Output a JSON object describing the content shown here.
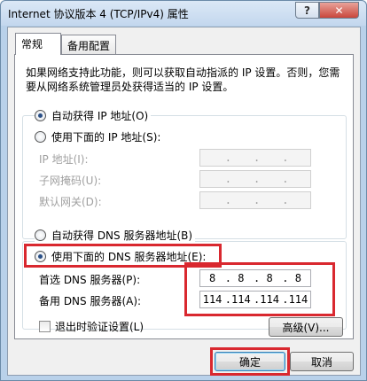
{
  "window": {
    "title": "Internet 协议版本 4 (TCP/IPv4) 属性",
    "help_glyph": "?",
    "close_glyph": "✕"
  },
  "tabs": [
    {
      "label": "常规",
      "active": true
    },
    {
      "label": "备用配置",
      "active": false
    }
  ],
  "description": "如果网络支持此功能，则可以获取自动指派的 IP 设置。否则，您需要从网络系统管理员处获得适当的 IP 设置。",
  "ip_section": {
    "auto_label": "自动获得 IP 地址(O)",
    "manual_label": "使用下面的 IP 地址(S):",
    "fields": [
      {
        "label": "IP 地址(I):",
        "octets": [
          "",
          "",
          "",
          ""
        ]
      },
      {
        "label": "子网掩码(U):",
        "octets": [
          "",
          "",
          "",
          ""
        ]
      },
      {
        "label": "默认网关(D):",
        "octets": [
          "",
          "",
          "",
          ""
        ]
      }
    ]
  },
  "dns_section": {
    "auto_label": "自动获得 DNS 服务器地址(B)",
    "manual_label": "使用下面的 DNS 服务器地址(E):",
    "fields": [
      {
        "label": "首选 DNS 服务器(P):",
        "octets": [
          "8",
          "8",
          "8",
          "8"
        ]
      },
      {
        "label": "备用 DNS 服务器(A):",
        "octets": [
          "114",
          "114",
          "114",
          "114"
        ]
      }
    ]
  },
  "validate_checkbox": "退出时验证设置(L)",
  "buttons": {
    "advanced": "高级(V)...",
    "ok": "确定",
    "cancel": "取消"
  },
  "colors": {
    "highlight": "#d9282f",
    "titlebar": "#c3d7ee"
  }
}
